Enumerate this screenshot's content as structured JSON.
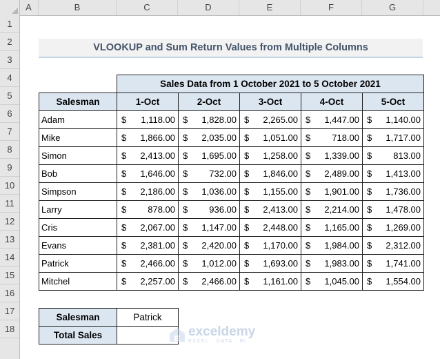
{
  "columns": [
    "A",
    "B",
    "C",
    "D",
    "E",
    "F",
    "G"
  ],
  "rows": [
    "1",
    "2",
    "3",
    "4",
    "5",
    "6",
    "7",
    "8",
    "9",
    "10",
    "11",
    "12",
    "13",
    "14",
    "15",
    "16",
    "17",
    "18"
  ],
  "title": "VLOOKUP and Sum Return Values from Multiple Columns",
  "table": {
    "group_header": "Sales Data from 1 October 2021 to 5 October 2021",
    "salesman_header": "Salesman",
    "date_headers": [
      "1-Oct",
      "2-Oct",
      "3-Oct",
      "4-Oct",
      "5-Oct"
    ],
    "currency": "$",
    "rows": [
      {
        "name": "Adam",
        "values": [
          "1,118.00",
          "1,828.00",
          "2,265.00",
          "1,447.00",
          "1,140.00"
        ]
      },
      {
        "name": "Mike",
        "values": [
          "1,866.00",
          "2,035.00",
          "1,051.00",
          "718.00",
          "1,717.00"
        ]
      },
      {
        "name": "Simon",
        "values": [
          "2,413.00",
          "1,695.00",
          "1,258.00",
          "1,339.00",
          "813.00"
        ]
      },
      {
        "name": "Bob",
        "values": [
          "1,646.00",
          "732.00",
          "1,846.00",
          "2,489.00",
          "1,413.00"
        ]
      },
      {
        "name": "Simpson",
        "values": [
          "2,186.00",
          "1,036.00",
          "1,155.00",
          "1,901.00",
          "1,736.00"
        ]
      },
      {
        "name": "Larry",
        "values": [
          "878.00",
          "936.00",
          "2,413.00",
          "2,214.00",
          "1,478.00"
        ]
      },
      {
        "name": "Cris",
        "values": [
          "2,067.00",
          "1,147.00",
          "2,448.00",
          "1,165.00",
          "1,269.00"
        ]
      },
      {
        "name": "Evans",
        "values": [
          "2,381.00",
          "2,420.00",
          "1,170.00",
          "1,984.00",
          "2,312.00"
        ]
      },
      {
        "name": "Patrick",
        "values": [
          "2,466.00",
          "1,012.00",
          "1,693.00",
          "1,983.00",
          "1,741.00"
        ]
      },
      {
        "name": "Mitchel",
        "values": [
          "2,257.00",
          "2,466.00",
          "1,161.00",
          "1,045.00",
          "1,554.00"
        ]
      }
    ]
  },
  "lookup": {
    "salesman_label": "Salesman",
    "salesman_value": "Patrick",
    "total_label": "Total Sales",
    "total_value": ""
  },
  "watermark": {
    "name": "exceldemy",
    "tagline": "EXCEL · DATA · BI"
  },
  "colors": {
    "header_fill": "#dce6f1",
    "title_fill": "#f2f2f2",
    "title_text": "#44546a"
  }
}
